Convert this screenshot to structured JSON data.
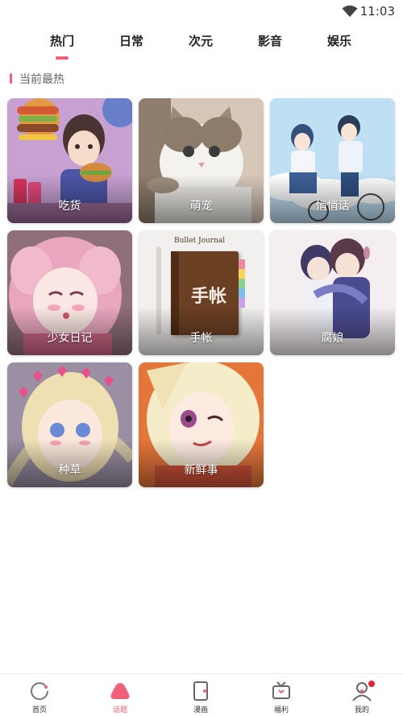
{
  "status_bar": {
    "time": "11:03",
    "icons": [
      "wifi-icon"
    ]
  },
  "tabs": [
    {
      "label": "热门",
      "active": true
    },
    {
      "label": "日常",
      "active": false
    },
    {
      "label": "次元",
      "active": false
    },
    {
      "label": "影音",
      "active": false
    },
    {
      "label": "娱乐",
      "active": false
    }
  ],
  "section": {
    "title": "当前最热"
  },
  "topics": [
    {
      "label": "吃货"
    },
    {
      "label": "萌宠"
    },
    {
      "label": "悄悄话"
    },
    {
      "label": "少女日记"
    },
    {
      "label": "手帐"
    },
    {
      "label": "腐娘"
    },
    {
      "label": "种草"
    },
    {
      "label": "新鲜事"
    }
  ],
  "artwork_text": {
    "journal_cover": "手帐",
    "journal_header": "Bullet Journal"
  },
  "bottom_nav": [
    {
      "label": "首页",
      "icon": "home-icon",
      "active": false
    },
    {
      "label": "话题",
      "icon": "topic-icon",
      "active": true
    },
    {
      "label": "漫画",
      "icon": "comic-icon",
      "active": false
    },
    {
      "label": "福利",
      "icon": "tv-gift-icon",
      "active": false
    },
    {
      "label": "我的",
      "icon": "profile-icon",
      "active": false,
      "badge": true
    }
  ],
  "colors": {
    "accent": "#f0607a",
    "badge": "#e8203a"
  }
}
